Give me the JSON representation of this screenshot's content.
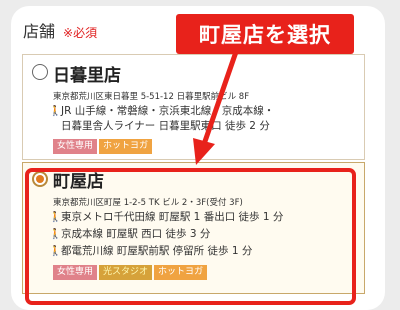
{
  "header": {
    "label": "店舗",
    "required": "※必須"
  },
  "callout": {
    "text": "町屋店を選択"
  },
  "stores": [
    {
      "name": "日暮里店",
      "address": "東京都荒川区東日暮里 5-51-12 日暮里駅前ビル 8F",
      "access": [
        "JR 山手線・常磐線・京浜東北線・京成本線・",
        "日暮里舎人ライナー 日暮里駅東口 徒歩 2 分"
      ],
      "tags": [
        "女性専用",
        "ホットヨガ"
      ],
      "selected": false
    },
    {
      "name": "町屋店",
      "address": "東京都荒川区町屋 1-2-5 TK ビル 2・3F(受付 3F)",
      "access": [
        "東京メトロ千代田線 町屋駅 1 番出口 徒歩 1 分",
        "京成本線 町屋駅 西口 徒歩 3 分",
        "都電荒川線 町屋駅前駅 停留所 徒歩 1 分"
      ],
      "tags": [
        "女性専用",
        "光スタジオ",
        "ホットヨガ"
      ],
      "selected": true
    }
  ],
  "colors": {
    "accent": "#e8221b",
    "radio_selected": "#e07a1f",
    "tag_pink": "#e0828a",
    "tag_orange": "#f0a341"
  },
  "icons": {
    "walk": "walking-person-icon"
  }
}
